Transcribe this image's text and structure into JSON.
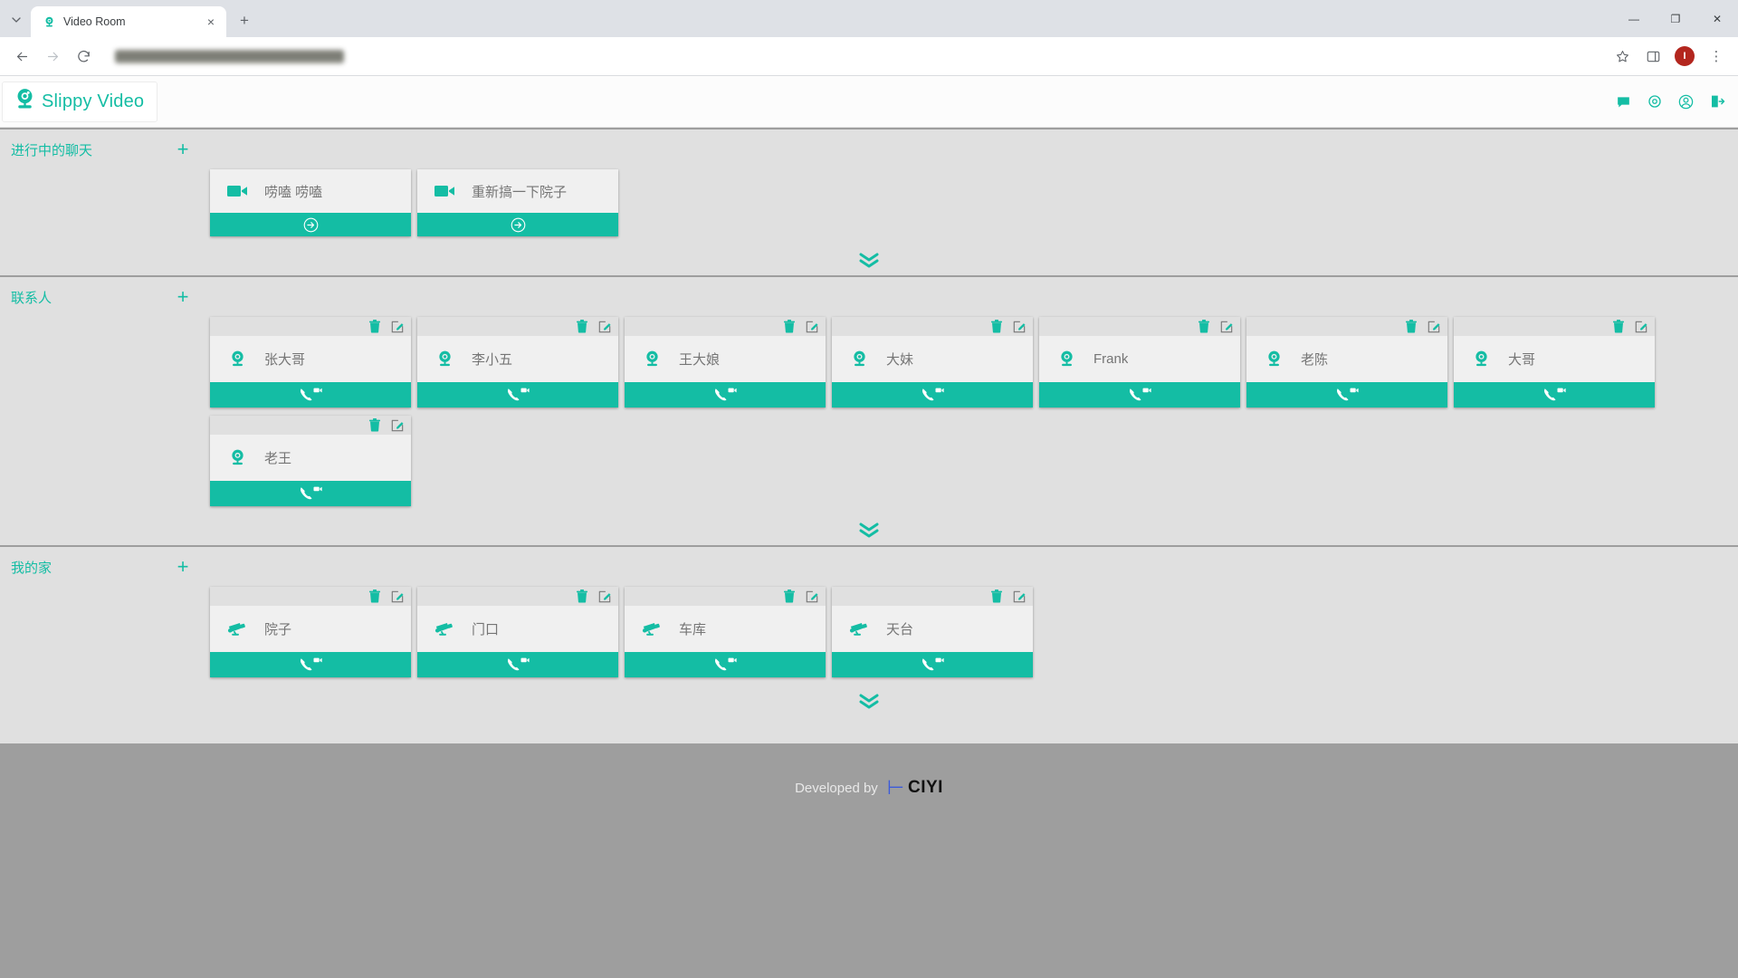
{
  "browser": {
    "tab": {
      "title": "Video Room",
      "favicon": "webcam-icon",
      "close_label": "×"
    },
    "tab_list_label": "˅",
    "new_tab_label": "+",
    "nav": {
      "back": "←",
      "forward": "→",
      "reload": "↻"
    },
    "address_value": "",
    "bookmark_label": "☆",
    "sidepanel_label": "◫",
    "profile_initial": "I",
    "menu_label": "⋮",
    "window": {
      "minimize": "—",
      "maximize": "❐",
      "close": "✕"
    }
  },
  "app": {
    "brand": {
      "name": "Slippy Video",
      "logo": "webcam-logo-icon"
    },
    "header_icons": [
      "chat-bubble-icon",
      "settings-gear-icon",
      "user-account-icon",
      "logout-icon"
    ],
    "add_label": "+",
    "expander_label": "chevrons-down-icon",
    "accent_color": "#14bda4",
    "sections": [
      {
        "id": "ongoing-chats",
        "title": "进行中的聊天",
        "card_type": "chat",
        "icon": "video-camera-icon",
        "action_icon": "arrow-right-circle-icon",
        "cards": [
          {
            "name": "唠嗑 唠嗑"
          },
          {
            "name": "重新搞一下院子"
          }
        ]
      },
      {
        "id": "contacts",
        "title": "联系人",
        "card_type": "contact",
        "icon": "webcam-icon",
        "action_icon": "phone-video-icon",
        "tools": [
          "delete-icon",
          "edit-icon"
        ],
        "cards": [
          {
            "name": "张大哥"
          },
          {
            "name": "李小五"
          },
          {
            "name": "王大娘"
          },
          {
            "name": "大妹"
          },
          {
            "name": "Frank"
          },
          {
            "name": "老陈"
          },
          {
            "name": "大哥"
          },
          {
            "name": "老王"
          }
        ]
      },
      {
        "id": "my-home",
        "title": "我的家",
        "card_type": "camera",
        "icon": "cctv-camera-icon",
        "action_icon": "phone-video-icon",
        "tools": [
          "delete-icon",
          "edit-icon"
        ],
        "cards": [
          {
            "name": "院子"
          },
          {
            "name": "门口"
          },
          {
            "name": "车库"
          },
          {
            "name": "天台"
          }
        ]
      }
    ],
    "footer": {
      "text": "Developed by",
      "logo_mark": "⊢",
      "logo_text": "CIYI"
    }
  }
}
